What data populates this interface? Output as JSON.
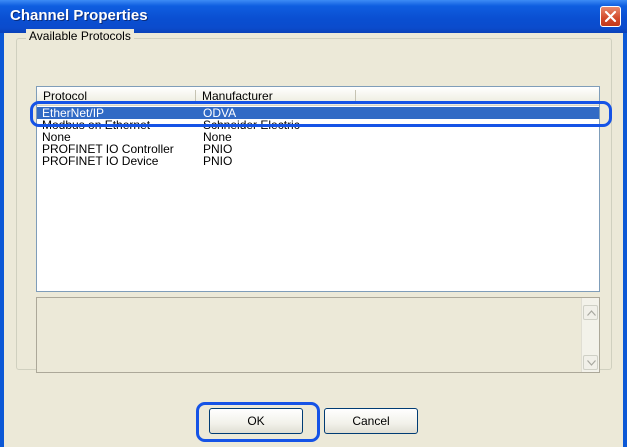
{
  "window": {
    "title": "Channel Properties"
  },
  "group": {
    "label": "Available Protocols"
  },
  "list": {
    "columns": [
      "Protocol",
      "Manufacturer"
    ],
    "rows": [
      {
        "protocol": "EtherNet/IP",
        "manufacturer": "ODVA",
        "selected": true
      },
      {
        "protocol": "Modbus on Ethernet",
        "manufacturer": "Schneider Electric",
        "selected": false
      },
      {
        "protocol": "None",
        "manufacturer": "None",
        "selected": false
      },
      {
        "protocol": "PROFINET IO Controller",
        "manufacturer": "PNIO",
        "selected": false
      },
      {
        "protocol": "PROFINET IO Device",
        "manufacturer": "PNIO",
        "selected": false
      }
    ]
  },
  "buttons": {
    "ok": "OK",
    "cancel": "Cancel"
  },
  "icons": {
    "close": "close-icon",
    "scroll_up": "scroll-up-arrow-icon",
    "scroll_down": "scroll-down-arrow-icon"
  },
  "colors": {
    "title_bar": "#0a4fd2",
    "selection": "#316ac5",
    "highlight_ring": "#1553e6",
    "close_button": "#d2492a"
  }
}
